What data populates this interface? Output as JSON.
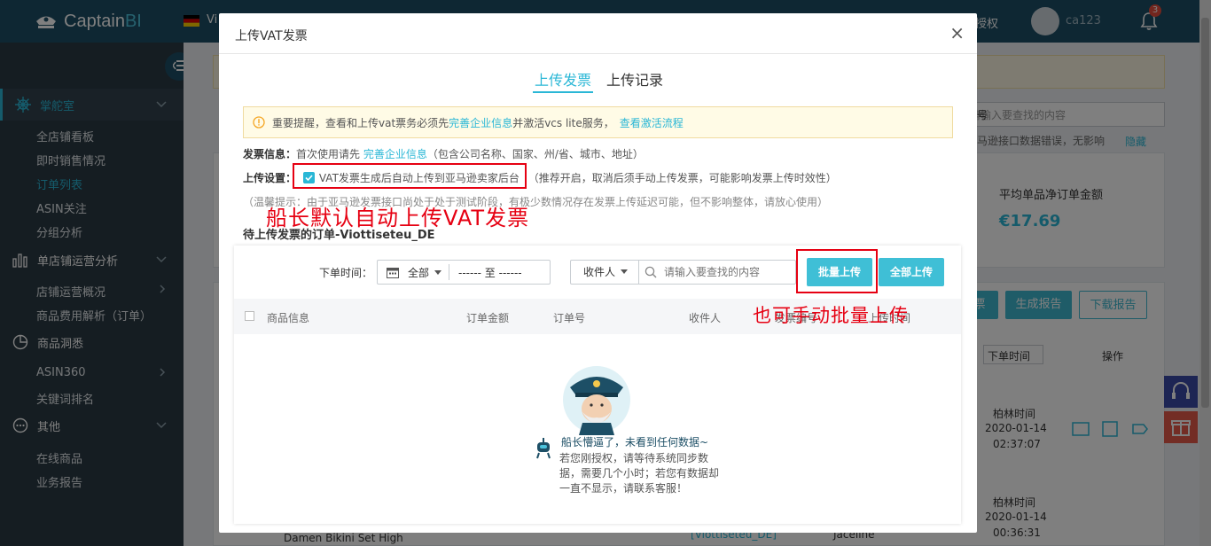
{
  "topbar": {
    "logo_prefix": "Captain",
    "logo_suffix": "BI",
    "marketplace": "Vi",
    "auth_label": "授权",
    "username": "ca123",
    "notifications": "3"
  },
  "sidebar": {
    "groups": [
      {
        "label": "掌舵室",
        "icon": "ship-wheel-icon",
        "active": true
      },
      {
        "label": "单店铺运营分析",
        "icon": "bar-chart-icon"
      },
      {
        "label": "商品洞悉",
        "icon": "pie-chart-icon"
      },
      {
        "label": "其他",
        "icon": "more-icon"
      }
    ],
    "items": [
      "全店铺看板",
      "即时销售情况",
      "订单列表",
      "ASIN关注",
      "分组分析",
      "店铺运营概况",
      "商品费用解析（订单）",
      "ASIN360",
      "关键词排名",
      "在线商品",
      "业务报告"
    ]
  },
  "background": {
    "search_placeholder": "请输入要查找的内容",
    "select_suffix": "号",
    "notice_text": "马逊接口数据错误，无影响",
    "hide_label": "隐藏",
    "metric_label": "平均单品净订单金额",
    "metric_value": "€17.69",
    "btn_partial": "票",
    "btn_report": "生成报告",
    "btn_download": "下载报告",
    "col_time": "下单时间",
    "col_ops": "操作",
    "rows": [
      {
        "tz": "柏林时间",
        "date": "2020-01-14",
        "time": "02:37:07"
      },
      {
        "tz": "柏林时间",
        "date": "2020-01-14",
        "time": "00:36:31"
      }
    ],
    "product_name": "Damen Bikini Set High",
    "shop_tag": "[Viottiseteu_DE]",
    "buyer": "Jaceline"
  },
  "modal": {
    "title": "上传VAT发票",
    "close": "×",
    "tabs": [
      "上传发票",
      "上传记录"
    ],
    "notice": {
      "text1": "重要提醒，查看和上传vat票务必须先",
      "link1": "完善企业信息",
      "text2": "并激活vcs lite服务，",
      "link2": "查看激活流程"
    },
    "invoice_info": {
      "key": "发票信息：",
      "text1": "首次使用请先",
      "link": "完善企业信息",
      "text2": "（包含公司名称、国家、州/省、城市、地址）"
    },
    "upload_setting": {
      "key": "上传设置：",
      "checkbox_label": "VAT发票生成后自动上传到亚马逊卖家后台",
      "hint": "（推荐开启，取消后须手动上传发票，可能影响发票上传时效性）"
    },
    "tip": "（温馨提示：由于亚马逊发票接口尚处于处于测试阶段，有极少数情况存在发票上传延迟可能，但不影响整体，请放心使用）",
    "annotation_auto": "船长默认自动上传VAT发票",
    "annotation_batch": "也可手动批量上传",
    "section_title": "待上传发票的订单-Viottiseteu_DE",
    "filter": {
      "time_label": "下单时间：",
      "range_all": "全部",
      "range_text": "------ 至 ------",
      "receiver_select": "收件人",
      "search_placeholder": "请输入要查找的内容",
      "batch_upload": "批量上传",
      "upload_all": "全部上传"
    },
    "table_headers": [
      "商品信息",
      "订单金额",
      "订单号",
      "收件人",
      "发票编号",
      "上传时间"
    ],
    "empty": {
      "title": "船长懵逼了，未看到任何数据~",
      "desc": "若您刚授权，请等待系统同步数据，需要几个小时；若您有数据却一直不显示，请联系客服！"
    }
  },
  "colors": {
    "accent": "#2ab7d6",
    "topbar": "#1d4f66",
    "sidebar": "#2b3a44",
    "annotation": "#e60012"
  }
}
